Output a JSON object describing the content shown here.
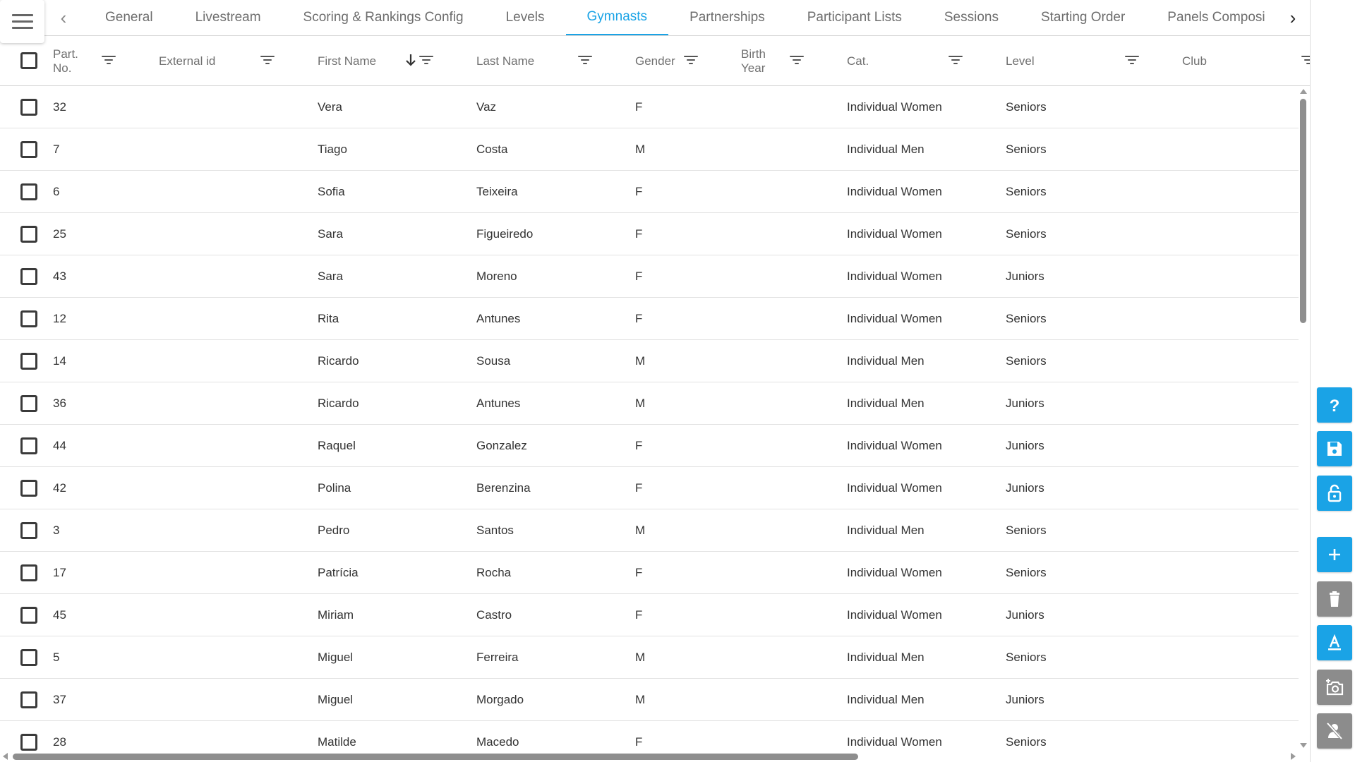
{
  "menu": {
    "icon": "hamburger-menu-icon"
  },
  "tabs": {
    "items": [
      {
        "label": "General"
      },
      {
        "label": "Livestream"
      },
      {
        "label": "Scoring & Rankings Config"
      },
      {
        "label": "Levels"
      },
      {
        "label": "Gymnasts",
        "active": true
      },
      {
        "label": "Partnerships"
      },
      {
        "label": "Participant Lists"
      },
      {
        "label": "Sessions"
      },
      {
        "label": "Starting Order"
      },
      {
        "label": "Panels Composi"
      }
    ],
    "accent_color": "#1aa3e6"
  },
  "table": {
    "columns": {
      "part_no": "Part.\nNo.",
      "external_id": "External id",
      "first_name": "First Name",
      "last_name": "Last Name",
      "gender": "Gender",
      "birth_year": "Birth\nYear",
      "cat": "Cat.",
      "level": "Level",
      "club": "Club"
    },
    "sorted_column": "first_name",
    "sort_direction": "descending",
    "rows": [
      {
        "part_no": "32",
        "external_id": "",
        "first_name": "Vera",
        "last_name": "Vaz",
        "gender": "F",
        "birth_year": "",
        "cat": "Individual Women",
        "level": "Seniors",
        "club": ""
      },
      {
        "part_no": "7",
        "external_id": "",
        "first_name": "Tiago",
        "last_name": "Costa",
        "gender": "M",
        "birth_year": "",
        "cat": "Individual Men",
        "level": "Seniors",
        "club": ""
      },
      {
        "part_no": "6",
        "external_id": "",
        "first_name": "Sofia",
        "last_name": "Teixeira",
        "gender": "F",
        "birth_year": "",
        "cat": "Individual Women",
        "level": "Seniors",
        "club": ""
      },
      {
        "part_no": "25",
        "external_id": "",
        "first_name": "Sara",
        "last_name": "Figueiredo",
        "gender": "F",
        "birth_year": "",
        "cat": "Individual Women",
        "level": "Seniors",
        "club": ""
      },
      {
        "part_no": "43",
        "external_id": "",
        "first_name": "Sara",
        "last_name": "Moreno",
        "gender": "F",
        "birth_year": "",
        "cat": "Individual Women",
        "level": "Juniors",
        "club": ""
      },
      {
        "part_no": "12",
        "external_id": "",
        "first_name": "Rita",
        "last_name": "Antunes",
        "gender": "F",
        "birth_year": "",
        "cat": "Individual Women",
        "level": "Seniors",
        "club": ""
      },
      {
        "part_no": "14",
        "external_id": "",
        "first_name": "Ricardo",
        "last_name": "Sousa",
        "gender": "M",
        "birth_year": "",
        "cat": "Individual Men",
        "level": "Seniors",
        "club": ""
      },
      {
        "part_no": "36",
        "external_id": "",
        "first_name": "Ricardo",
        "last_name": "Antunes",
        "gender": "M",
        "birth_year": "",
        "cat": "Individual Men",
        "level": "Juniors",
        "club": ""
      },
      {
        "part_no": "44",
        "external_id": "",
        "first_name": "Raquel",
        "last_name": "Gonzalez",
        "gender": "F",
        "birth_year": "",
        "cat": "Individual Women",
        "level": "Juniors",
        "club": ""
      },
      {
        "part_no": "42",
        "external_id": "",
        "first_name": "Polina",
        "last_name": "Berenzina",
        "gender": "F",
        "birth_year": "",
        "cat": "Individual Women",
        "level": "Juniors",
        "club": ""
      },
      {
        "part_no": "3",
        "external_id": "",
        "first_name": "Pedro",
        "last_name": "Santos",
        "gender": "M",
        "birth_year": "",
        "cat": "Individual Men",
        "level": "Seniors",
        "club": ""
      },
      {
        "part_no": "17",
        "external_id": "",
        "first_name": "Patrícia",
        "last_name": "Rocha",
        "gender": "F",
        "birth_year": "",
        "cat": "Individual Women",
        "level": "Seniors",
        "club": ""
      },
      {
        "part_no": "45",
        "external_id": "",
        "first_name": "Miriam",
        "last_name": "Castro",
        "gender": "F",
        "birth_year": "",
        "cat": "Individual Women",
        "level": "Juniors",
        "club": ""
      },
      {
        "part_no": "5",
        "external_id": "",
        "first_name": "Miguel",
        "last_name": "Ferreira",
        "gender": "M",
        "birth_year": "",
        "cat": "Individual Men",
        "level": "Seniors",
        "club": ""
      },
      {
        "part_no": "37",
        "external_id": "",
        "first_name": "Miguel",
        "last_name": "Morgado",
        "gender": "M",
        "birth_year": "",
        "cat": "Individual Men",
        "level": "Juniors",
        "club": ""
      },
      {
        "part_no": "28",
        "external_id": "",
        "first_name": "Matilde",
        "last_name": "Macedo",
        "gender": "F",
        "birth_year": "",
        "cat": "Individual Women",
        "level": "Seniors",
        "club": ""
      }
    ]
  },
  "sidebar": {
    "buttons": [
      {
        "name": "help-button",
        "icon": "help-icon",
        "color": "#1aa3e6"
      },
      {
        "name": "save-button",
        "icon": "save-icon",
        "color": "#1aa3e6"
      },
      {
        "name": "lock-button",
        "icon": "unlock-icon",
        "color": "#1aa3e6"
      },
      {
        "name": "add-button",
        "icon": "plus-icon",
        "color": "#1aa3e6"
      },
      {
        "name": "delete-button",
        "icon": "trash-icon",
        "color": "#8c8c8c"
      },
      {
        "name": "format-button",
        "icon": "text-format-icon",
        "color": "#1aa3e6"
      },
      {
        "name": "add-photo-button",
        "icon": "add-camera-icon",
        "color": "#8c8c8c"
      },
      {
        "name": "remove-user-button",
        "icon": "user-off-icon",
        "color": "#8c8c8c"
      }
    ]
  }
}
